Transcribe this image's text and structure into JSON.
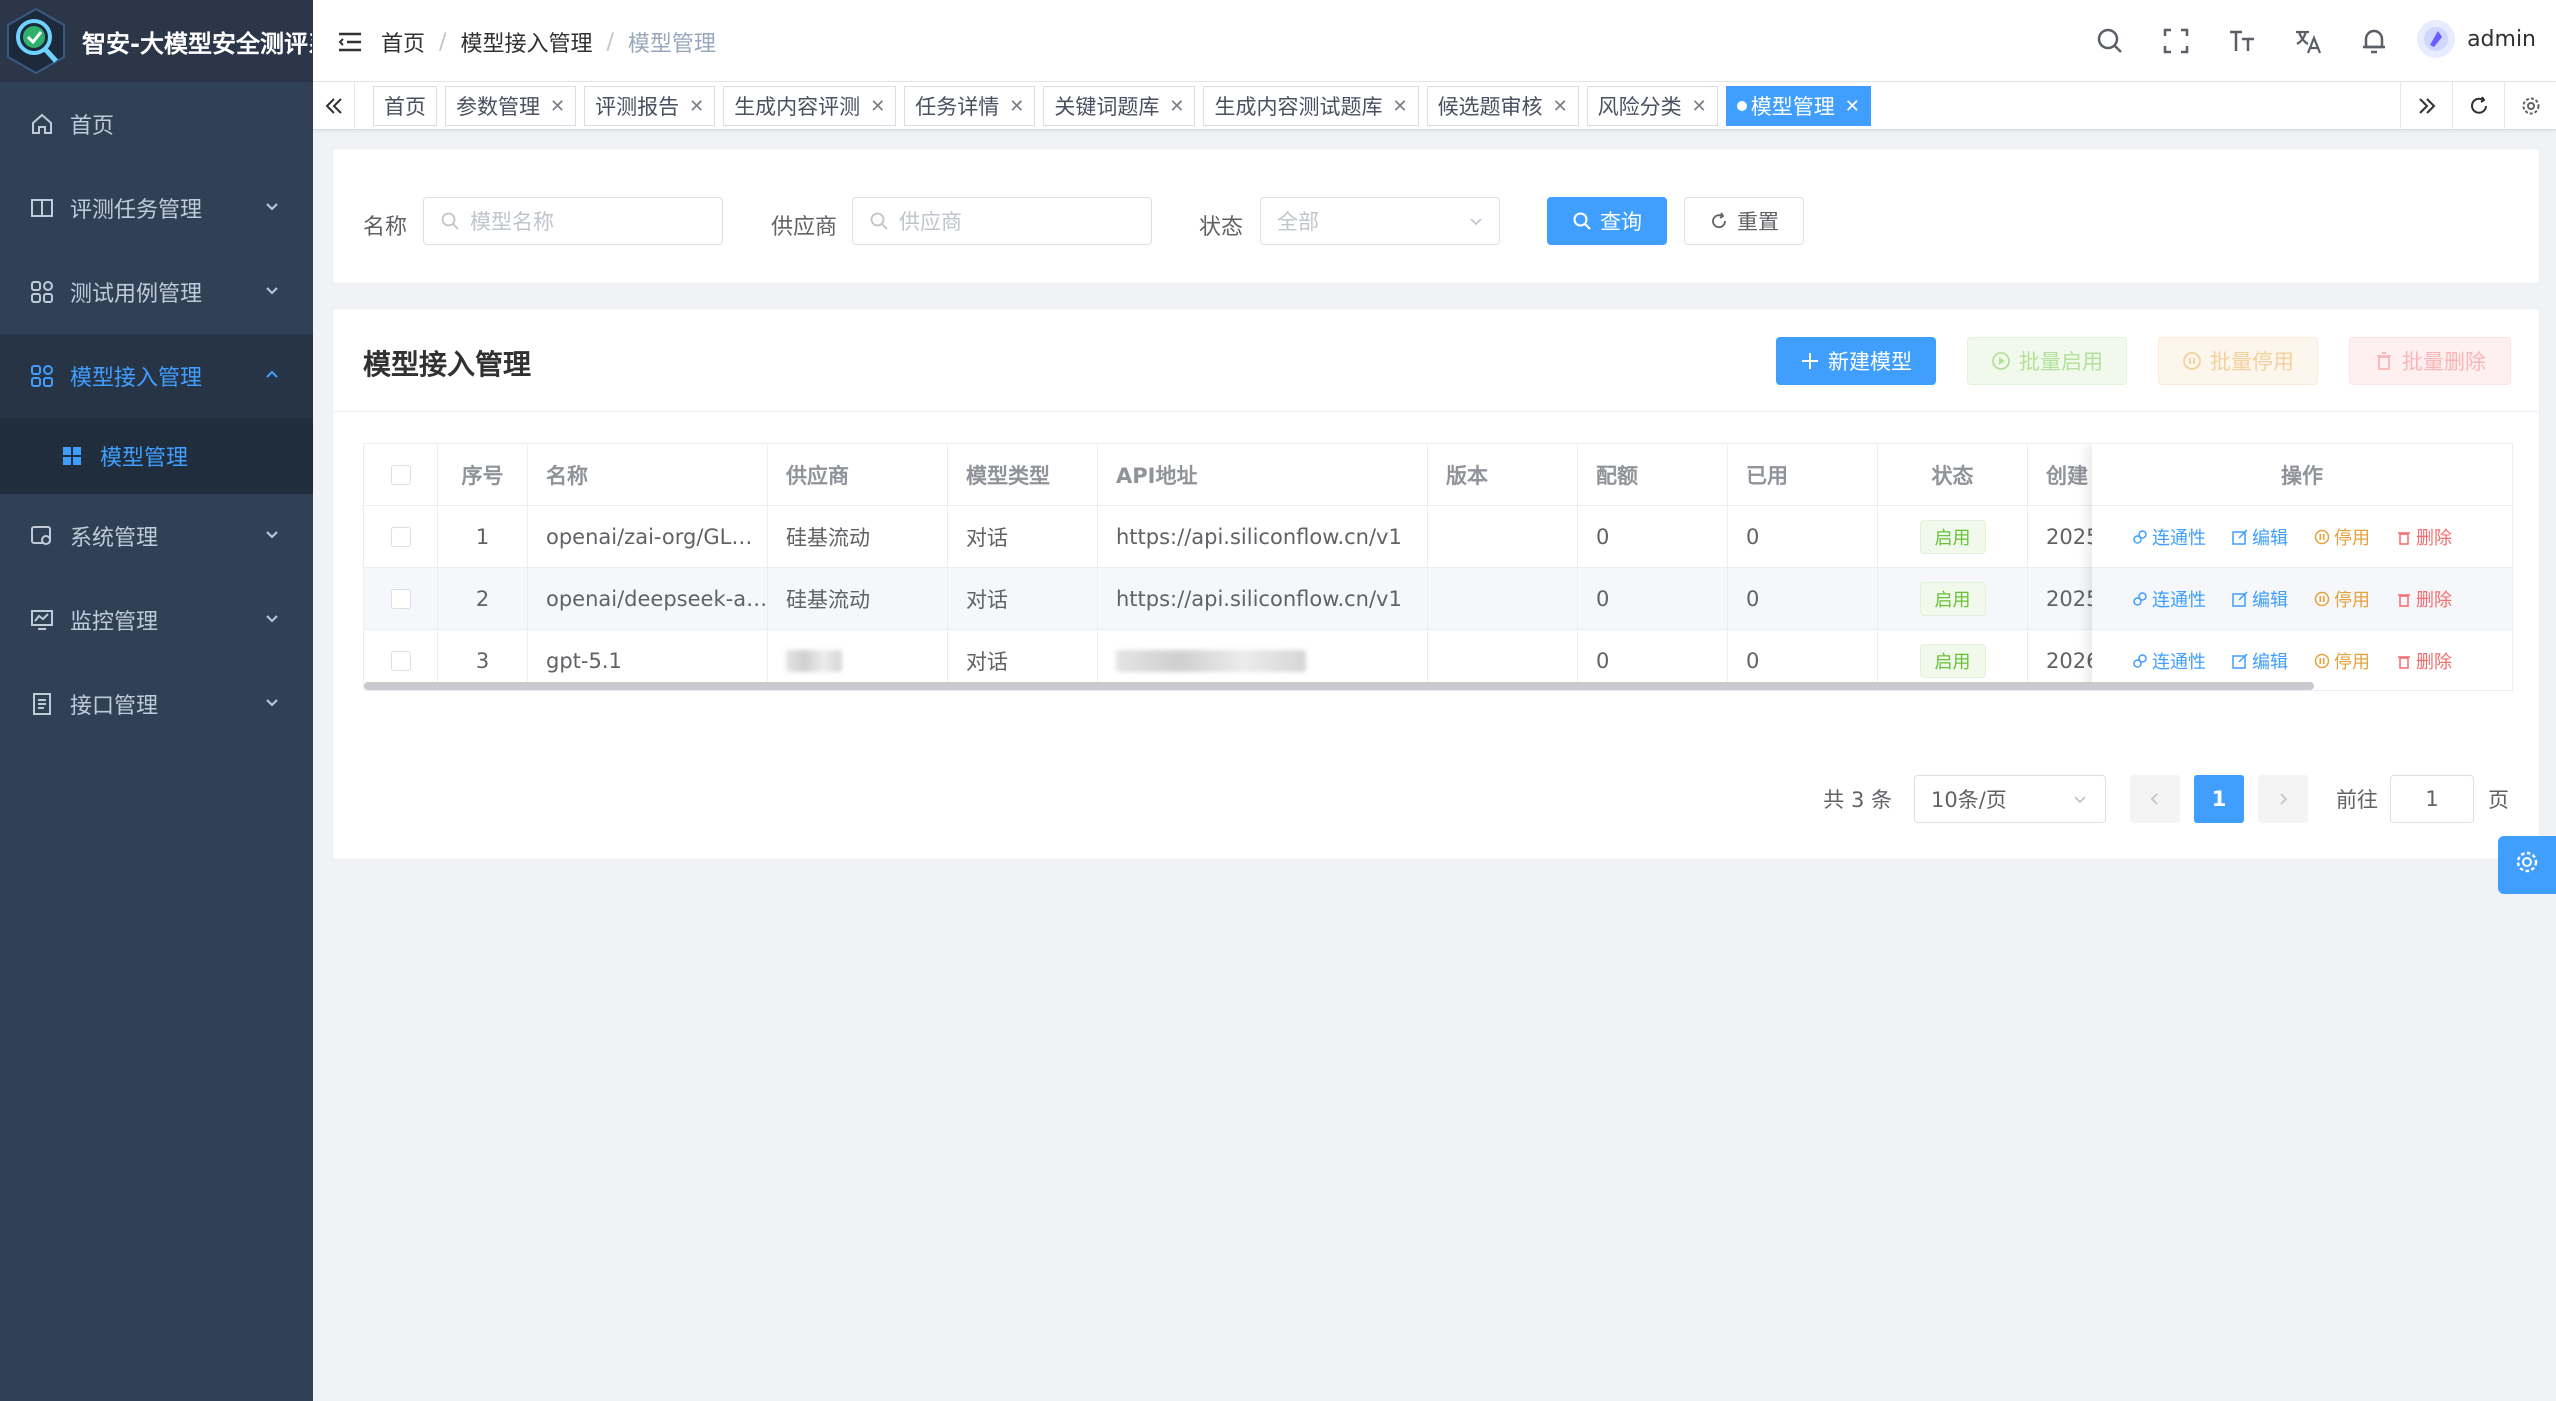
{
  "app": {
    "title": "智安-大模型安全测评系统"
  },
  "sidebar": {
    "items": [
      {
        "label": "首页",
        "icon": "home-icon"
      },
      {
        "label": "评测任务管理",
        "icon": "book-icon"
      },
      {
        "label": "测试用例管理",
        "icon": "grid-icon"
      },
      {
        "label": "模型接入管理",
        "icon": "grid-icon"
      },
      {
        "label": "模型管理",
        "icon": "tiles-icon"
      },
      {
        "label": "系统管理",
        "icon": "system-icon"
      },
      {
        "label": "监控管理",
        "icon": "monitor-icon"
      },
      {
        "label": "接口管理",
        "icon": "doc-icon"
      }
    ]
  },
  "header": {
    "breadcrumb": [
      "首页",
      "模型接入管理",
      "模型管理"
    ],
    "user": "admin"
  },
  "tags": [
    {
      "label": "首页",
      "closable": false
    },
    {
      "label": "参数管理",
      "closable": true
    },
    {
      "label": "评测报告",
      "closable": true
    },
    {
      "label": "生成内容评测",
      "closable": true
    },
    {
      "label": "任务详情",
      "closable": true
    },
    {
      "label": "关键词题库",
      "closable": true
    },
    {
      "label": "生成内容测试题库",
      "closable": true
    },
    {
      "label": "候选题审核",
      "closable": true
    },
    {
      "label": "风险分类",
      "closable": true
    },
    {
      "label": "模型管理",
      "closable": true,
      "active": true
    }
  ],
  "search": {
    "name_label": "名称",
    "name_placeholder": "模型名称",
    "vendor_label": "供应商",
    "vendor_placeholder": "供应商",
    "status_label": "状态",
    "status_value": "全部",
    "query_label": "查询",
    "reset_label": "重置"
  },
  "table": {
    "title": "模型接入管理",
    "actions": {
      "add": "新建模型",
      "batch_enable": "批量启用",
      "batch_disable": "批量停用",
      "batch_delete": "批量删除"
    },
    "columns": [
      "序号",
      "名称",
      "供应商",
      "模型类型",
      "API地址",
      "版本",
      "配额",
      "已用",
      "状态",
      "创建",
      "操作"
    ],
    "rows": [
      {
        "index": "1",
        "name": "openai/zai-org/GL…",
        "vendor": "硅基流动",
        "type": "对话",
        "api": "https://api.siliconflow.cn/v1",
        "version": "",
        "quota": "0",
        "used": "0",
        "status": "启用",
        "created": "2025"
      },
      {
        "index": "2",
        "name": "openai/deepseek-a…",
        "vendor": "硅基流动",
        "type": "对话",
        "api": "https://api.siliconflow.cn/v1",
        "version": "",
        "quota": "0",
        "used": "0",
        "status": "启用",
        "created": "2025"
      },
      {
        "index": "3",
        "name": "gpt-5.1",
        "vendor": "",
        "type": "对话",
        "api": "",
        "version": "",
        "quota": "0",
        "used": "0",
        "status": "启用",
        "created": "2026"
      }
    ],
    "row_ops": {
      "test": "连通性",
      "edit": "编辑",
      "disable": "停用",
      "delete": "删除"
    }
  },
  "pagination": {
    "total": "共 3 条",
    "page_size": "10条/页",
    "current": "1",
    "goto_label": "前往",
    "goto_value": "1",
    "page_suffix": "页"
  },
  "colors": {
    "primary": "#409eff",
    "sidebar_bg": "#304156",
    "success": "#67c23a",
    "warning": "#e6a23c",
    "danger": "#f56c6c"
  }
}
